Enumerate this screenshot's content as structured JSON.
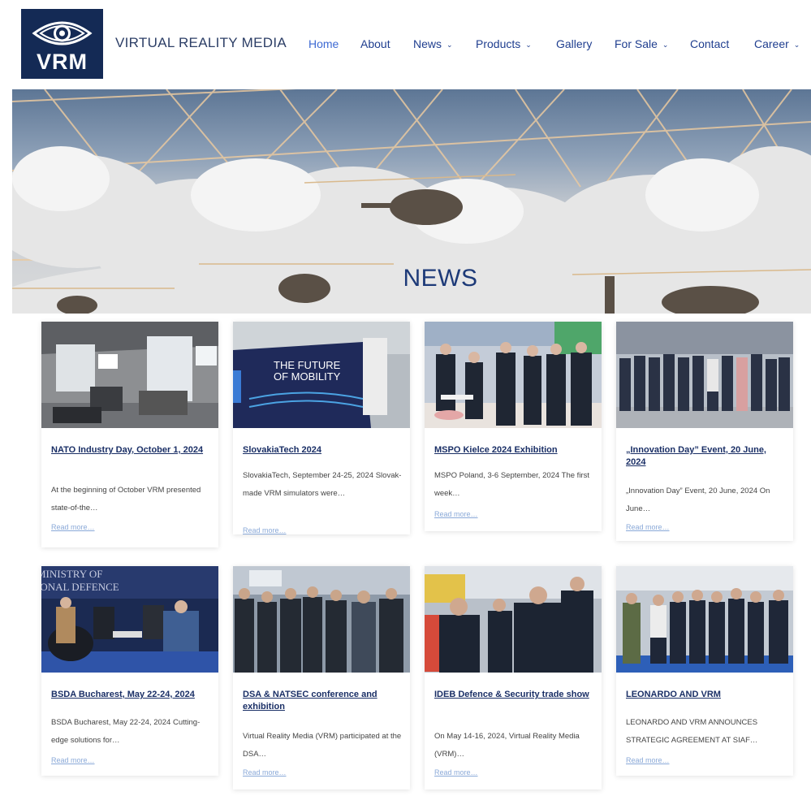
{
  "brand": {
    "logo_text": "VRM",
    "name": "VIRTUAL REALITY MEDIA"
  },
  "nav": {
    "items": [
      {
        "label": "Home",
        "dropdown": false,
        "active": true
      },
      {
        "label": "About",
        "dropdown": false
      },
      {
        "label": "News",
        "dropdown": true
      },
      {
        "label": "Products",
        "dropdown": true
      },
      {
        "label": "Gallery",
        "dropdown": false
      },
      {
        "label": "For Sale",
        "dropdown": true
      },
      {
        "label": "Contact",
        "dropdown": false
      },
      {
        "label": "Career",
        "dropdown": true
      }
    ],
    "chevron": "⌄"
  },
  "hero": {
    "title": "NEWS"
  },
  "posts": [
    {
      "title": "NATO Industry Day, October 1, 2024",
      "excerpt": "At the beginning of October VRM presented state-of-the…",
      "more": "Read more…"
    },
    {
      "title": "SlovakiaTech 2024",
      "excerpt": "SlovakiaTech, September 24-25, 2024 Slovak-made VRM simulators were…",
      "more": "Read more…"
    },
    {
      "title": "MSPO Kielce 2024 Exhibition",
      "excerpt": "MSPO Poland, 3-6 September, 2024 The first week…",
      "more": "Read more…"
    },
    {
      "title": "„Innovation Day” Event, 20 June, 2024",
      "excerpt": "„Innovation Day” Event, 20 June, 2024 On June…",
      "more": "Read more…"
    },
    {
      "title": "BSDA Bucharest, May 22-24, 2024",
      "excerpt": "BSDA Bucharest, May 22-24, 2024 Cutting-edge solutions for…",
      "more": "Read more…"
    },
    {
      "title": "DSA & NATSEC conference and exhibition",
      "excerpt": "Virtual Reality Media (VRM) participated at the DSA…",
      "more": "Read more…"
    },
    {
      "title": "IDEB Defence & Security trade show",
      "excerpt": "On May 14-16, 2024, Virtual Reality Media (VRM)…",
      "more": "Read more…"
    },
    {
      "title": "LEONARDO AND VRM",
      "excerpt": "LEONARDO AND VRM ANNOUNCES STRATEGIC AGREEMENT AT SIAF…",
      "more": "Read more…"
    }
  ],
  "image_text": {
    "slovakiatech_banner": "THE FUTURE OF MOBILITY",
    "bsda_backdrop": "MINISTRY OF NATIONAL DEFENCE"
  },
  "colors": {
    "logo_bg": "#142a55",
    "nav_text": "#1f3e8f",
    "nav_active": "#3e6ad3",
    "title_link": "#1a2f66",
    "read_more": "#8aa9d8"
  }
}
